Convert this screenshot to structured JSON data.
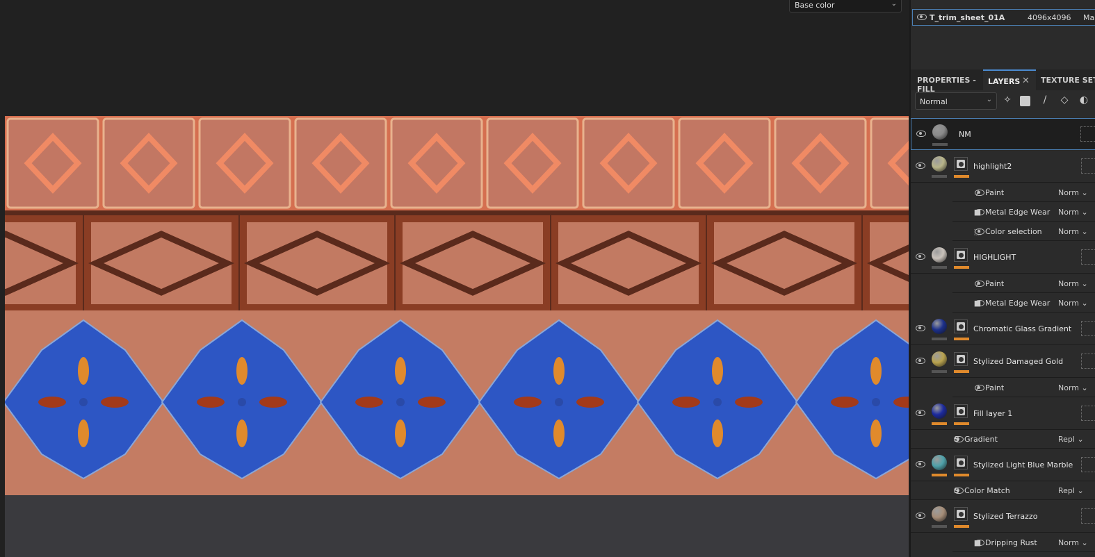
{
  "viewport": {
    "channel_select": "Base color"
  },
  "texture_set": {
    "name": "T_trim_sheet_01A",
    "resolution": "4096x4096",
    "shader": "Ma"
  },
  "tabs": [
    {
      "label": "PROPERTIES - FILL"
    },
    {
      "label": "LAYERS",
      "active": true
    },
    {
      "label": "TEXTURE SET S"
    }
  ],
  "toolbar": {
    "blend_mode": "Normal",
    "tools": [
      "magic-wand-icon",
      "mask-icon",
      "paint-brush-icon",
      "fill-bucket-icon",
      "smart-material-icon"
    ]
  },
  "layers": [
    {
      "type": "layer",
      "name": "NM",
      "selected": true,
      "ball": "#8a8a8a",
      "mask": false,
      "bars": [
        "gray"
      ]
    },
    {
      "type": "layer",
      "name": "highlight2",
      "ball": "#b8b58a",
      "mask": true,
      "bars": [
        "gray",
        "orange"
      ]
    },
    {
      "type": "effect",
      "name": "Paint",
      "icon": "brush",
      "blend": "Norm"
    },
    {
      "type": "effect",
      "name": "Metal Edge Wear",
      "icon": "mask",
      "blend": "Norm"
    },
    {
      "type": "effect",
      "name": "Color selection",
      "icon": "selection",
      "blend": "Norm"
    },
    {
      "type": "layer",
      "name": "HIGHLIGHT",
      "ball": "#c9c2bb",
      "mask": true,
      "bars": [
        "gray",
        "orange"
      ]
    },
    {
      "type": "effect",
      "name": "Paint",
      "icon": "brush",
      "blend": "Norm"
    },
    {
      "type": "effect",
      "name": "Metal Edge Wear",
      "icon": "mask",
      "blend": "Norm"
    },
    {
      "type": "layer",
      "name": "Chromatic Glass Gradient",
      "ball": "#1b2f8a",
      "mask": true,
      "bars": [
        "gray",
        "orange"
      ]
    },
    {
      "type": "layer",
      "name": "Stylized Damaged Gold",
      "ball": "#b9a34f",
      "mask": true,
      "bars": [
        "gray",
        "orange"
      ]
    },
    {
      "type": "effect",
      "name": "Paint",
      "icon": "brush",
      "blend": "Norm"
    },
    {
      "type": "layer",
      "name": "Fill layer 1",
      "ball": "#1c2a9e",
      "mask": true,
      "bars": [
        "orange",
        "orange"
      ]
    },
    {
      "type": "filter",
      "name": "Gradient",
      "icon": "substance",
      "blend": "Repl"
    },
    {
      "type": "layer",
      "name": "Stylized Light Blue Marble",
      "ball": "#4fa2aa",
      "mask": true,
      "bars": [
        "orange",
        "orange"
      ]
    },
    {
      "type": "filter",
      "name": "Color Match",
      "icon": "substance",
      "blend": "Repl"
    },
    {
      "type": "layer",
      "name": "Stylized Terrazzo",
      "ball": "#a58d78",
      "mask": true,
      "bars": [
        "gray",
        "orange"
      ]
    },
    {
      "type": "effect",
      "name": "Dripping Rust",
      "icon": "mask",
      "blend": "Norm"
    }
  ],
  "colors": {
    "accent": "#4b8ad0",
    "orange": "#e08a2c",
    "terracotta": "#c0705a",
    "blue": "#2a55c0"
  }
}
